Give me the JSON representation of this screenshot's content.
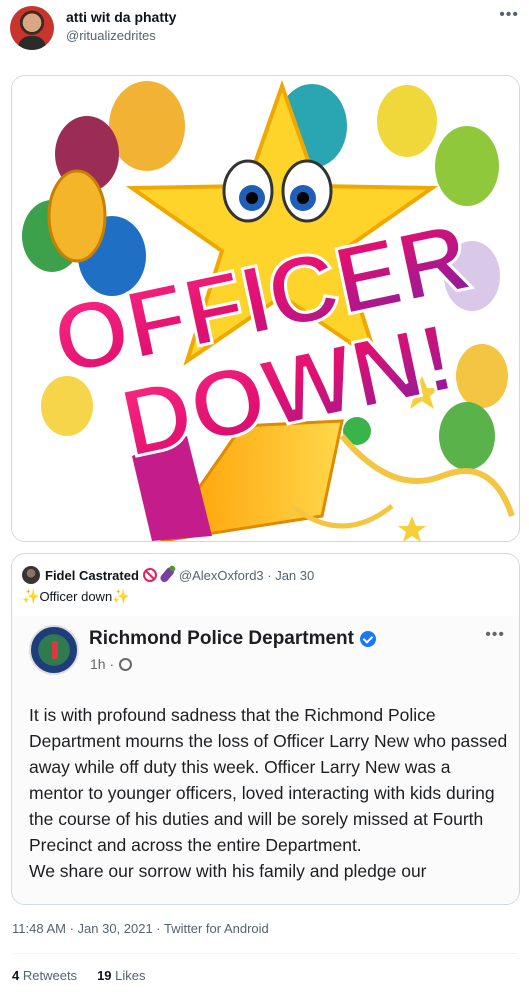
{
  "tweet": {
    "display_name": "atti wit da phatty",
    "handle": "@ritualizedrites",
    "more_icon": "ellipsis-icon",
    "image_text": {
      "line1": "OFFICER",
      "line2": "DOWN!"
    },
    "timestamp": "11:48 AM · Jan 30, 2021 · Twitter for Android",
    "retweets_count": "4",
    "retweets_label": "Retweets",
    "likes_count": "19",
    "likes_label": "Likes"
  },
  "quote": {
    "display_name": "Fidel Castrated",
    "handle_date": "@AlexOxford3 · Jan 30",
    "text": "Officer down",
    "icons": [
      "no-entry-icon",
      "eggplant-icon",
      "sparkle-icon"
    ],
    "facebook_post": {
      "page_name": "Richmond Police Department",
      "time": "1h ·",
      "paragraph1": "It is with profound sadness that the Richmond Police Department mourns the loss of Officer Larry New who passed away while off duty this week. Officer Larry New was a mentor to younger officers, loved interacting with kids during the course of his duties and will be sorely missed at Fourth Precinct and across the entire Department.",
      "paragraph2": "We share our sorrow with his family and pledge our"
    }
  },
  "colors": {
    "text_primary": "#0f1419",
    "text_secondary": "#536471",
    "border": "#cfd9de",
    "facebook_blue": "#1877f2"
  }
}
